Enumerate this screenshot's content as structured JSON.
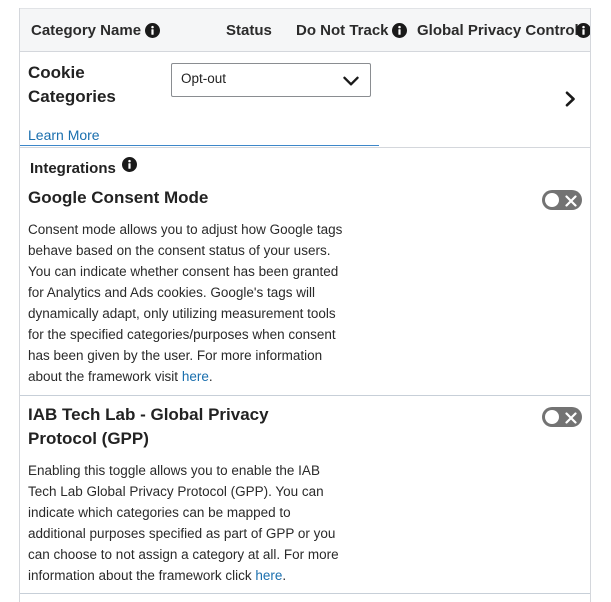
{
  "table_header": {
    "category_name": "Category Name",
    "status": "Status",
    "do_not_track": "Do Not Track",
    "global_privacy_control": "Global Privacy Control"
  },
  "cookie_row": {
    "title": "Cookie Categories",
    "learn_more": "Learn More",
    "status_select": {
      "selected": "Opt-out"
    }
  },
  "integrations": {
    "heading": "Integrations",
    "items": [
      {
        "title": "Google Consent Mode",
        "toggle_on": false,
        "description": "Consent mode allows you to adjust how Google tags behave based on the consent status of your users. You can indicate whether consent has been granted for Analytics and Ads cookies. Google's tags will dynamically adapt, only utilizing measurement tools for the specified categories/purposes when consent has been given by the user. For more information about the framework visit",
        "link_text": "here",
        "suffix": "."
      },
      {
        "title": "IAB Tech Lab - Global Privacy Protocol (GPP)",
        "toggle_on": false,
        "description": "Enabling this toggle allows you to enable the IAB Tech Lab Global Privacy Protocol (GPP). You can indicate which categories can be mapped to additional purposes specified as part of GPP or you can choose to not assign a category at all. For more information about the framework click",
        "link_text": "here",
        "suffix": "."
      }
    ]
  },
  "icons": {
    "info": "info-icon",
    "dropdown": "chevron-down-icon",
    "row_expand": "chevron-right-icon",
    "toggle_off": "close-icon"
  },
  "colors": {
    "link": "#1a6fae",
    "header_bg": "#f5f6f7",
    "toggle_off": "#737373",
    "focus_underline": "#3d87c9"
  }
}
